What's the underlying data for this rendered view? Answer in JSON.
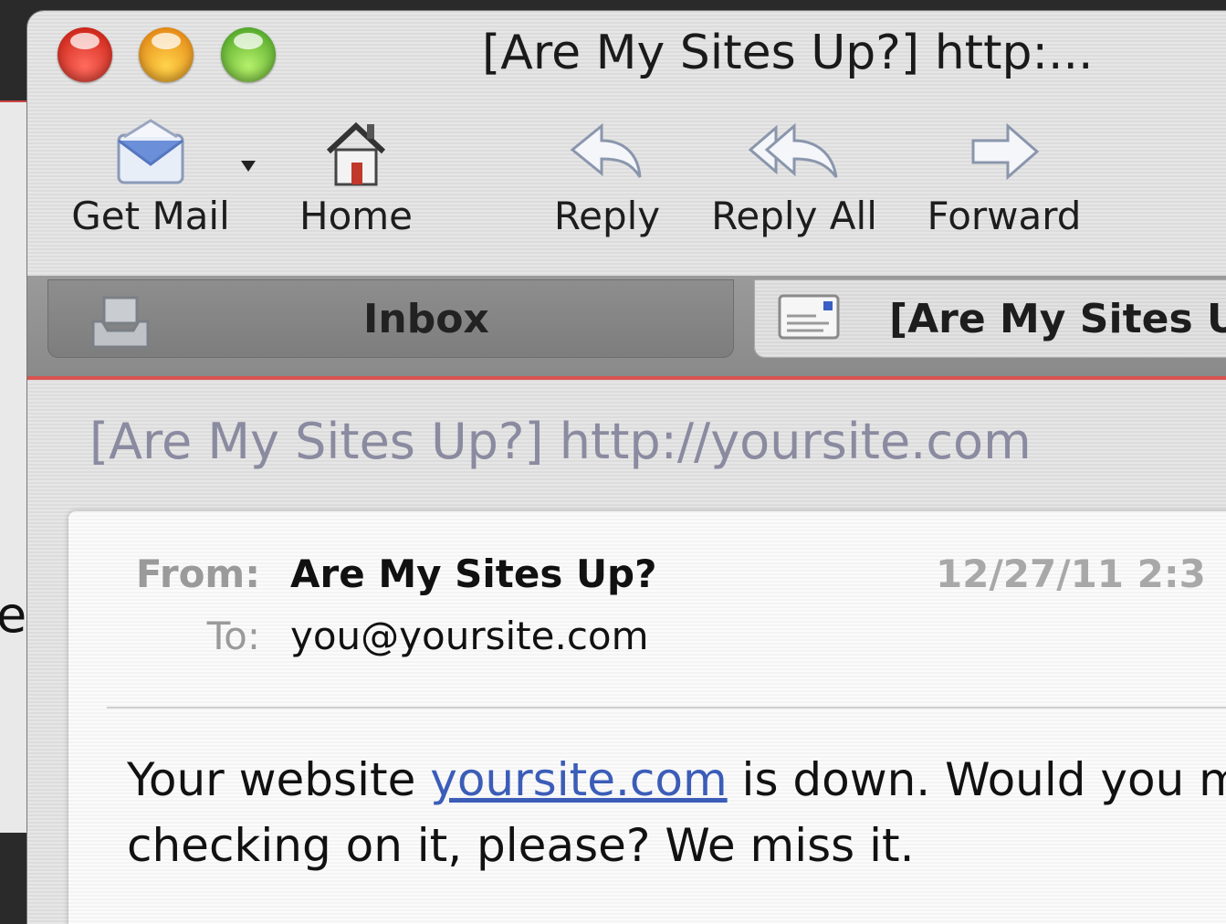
{
  "window": {
    "title": "[Are My Sites Up?] http:..."
  },
  "background_window": {
    "letter": "e"
  },
  "toolbar": {
    "get_mail": "Get Mail",
    "home": "Home",
    "reply": "Reply",
    "reply_all": "Reply All",
    "forward": "Forward"
  },
  "tabs": {
    "inbox": "Inbox",
    "message": "[Are My Sites U"
  },
  "message": {
    "subject": "[Are My Sites Up?] http://yoursite.com",
    "from_label": "From:",
    "from_value": "Are My Sites Up?",
    "to_label": "To:",
    "to_value": "you@yoursite.com",
    "date": "12/27/11 2:3",
    "body_prefix": "Your website ",
    "body_link": "yoursite.com",
    "body_suffix": " is down. Would you m",
    "body_line2": "checking on it, please? We miss it."
  },
  "colors": {
    "accent_red": "#d9534f",
    "link": "#3b5db8",
    "subject": "#8a8aa0"
  }
}
